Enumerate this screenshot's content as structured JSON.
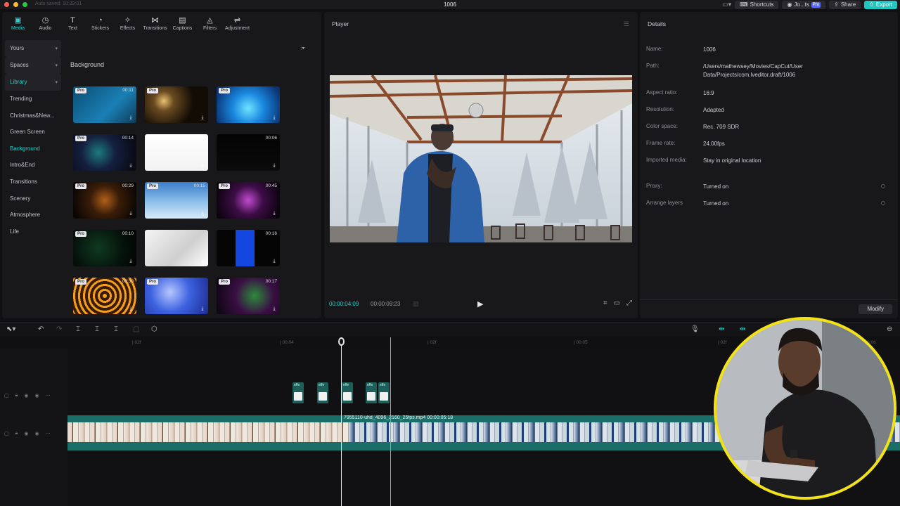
{
  "topbar": {
    "autosave": "Auto saved: 10:29:01",
    "project_title": "1006",
    "shortcuts_label": "Shortcuts",
    "user_label": "Jo...ts",
    "user_badge": "Pro",
    "share_label": "Share",
    "export_label": "Export"
  },
  "toolbar": {
    "tools": [
      {
        "label": "Media",
        "icon": "media-icon",
        "glyph": "▣"
      },
      {
        "label": "Audio",
        "icon": "audio-icon",
        "glyph": "◷"
      },
      {
        "label": "Text",
        "icon": "text-icon",
        "glyph": "T"
      },
      {
        "label": "Stickers",
        "icon": "stickers-icon",
        "glyph": "◔"
      },
      {
        "label": "Effects",
        "icon": "effects-icon",
        "glyph": "✧"
      },
      {
        "label": "Transitions",
        "icon": "transitions-icon",
        "glyph": "⋈"
      },
      {
        "label": "Captions",
        "icon": "captions-icon",
        "glyph": "▤"
      },
      {
        "label": "Filters",
        "icon": "filters-icon",
        "glyph": "◬"
      },
      {
        "label": "Adjustment",
        "icon": "adjustment-icon",
        "glyph": "⇌"
      }
    ]
  },
  "nav": {
    "items": [
      {
        "label": "Yours",
        "dropdown": true
      },
      {
        "label": "Spaces",
        "dropdown": true
      },
      {
        "label": "Library",
        "dropdown": true
      },
      {
        "label": "Trending"
      },
      {
        "label": "Christmas&New..."
      },
      {
        "label": "Green Screen"
      },
      {
        "label": "Background"
      },
      {
        "label": "Intro&End"
      },
      {
        "label": "Transitions"
      },
      {
        "label": "Scenery"
      },
      {
        "label": "Atmosphere"
      },
      {
        "label": "Life"
      }
    ]
  },
  "library": {
    "section_title": "Background",
    "filter_glyph": "⫶▾",
    "items": [
      {
        "pro": "Pro",
        "duration": "00:11"
      },
      {
        "pro": "Pro",
        "duration": ""
      },
      {
        "pro": "Pro",
        "duration": ""
      },
      {
        "pro": "Pro",
        "duration": "00:14"
      },
      {
        "pro": "",
        "duration": ""
      },
      {
        "pro": "",
        "duration": "00:06"
      },
      {
        "pro": "Pro",
        "duration": "00:29"
      },
      {
        "pro": "Pro",
        "duration": "00:15"
      },
      {
        "pro": "Pro",
        "duration": "00:45"
      },
      {
        "pro": "Pro",
        "duration": "00:10"
      },
      {
        "pro": "",
        "duration": ""
      },
      {
        "pro": "",
        "duration": "00:16"
      },
      {
        "pro": "Pro",
        "duration": "00:30"
      },
      {
        "pro": "Pro",
        "duration": ""
      },
      {
        "pro": "Pro",
        "duration": "00:17"
      }
    ]
  },
  "player": {
    "title": "Player",
    "current_time": "00:00:04:09",
    "total_time": "00:00:09:23"
  },
  "details": {
    "title": "Details",
    "rows": [
      {
        "key": "Name:",
        "value": "1006"
      },
      {
        "key": "Path:",
        "value": "/Users/mathewsey/Movies/CapCut/User Data/Projects/com.lveditor.draft/1006"
      },
      {
        "key": "Aspect ratio:",
        "value": "16:9"
      },
      {
        "key": "Resolution:",
        "value": "Adapted"
      },
      {
        "key": "Color space:",
        "value": "Rec. 709 SDR"
      },
      {
        "key": "Frame rate:",
        "value": "24.00fps"
      },
      {
        "key": "Imported media:",
        "value": "Stay in original location"
      },
      {
        "key": "Proxy:",
        "value": "Turned on"
      },
      {
        "key": "Arrange layers",
        "value": "Turned on"
      }
    ],
    "modify_label": "Modify"
  },
  "timeline": {
    "ruler": [
      "| 02f",
      "| 00:04",
      "| 02f",
      "| 00:05",
      "| 02f",
      "| 00:06"
    ],
    "clip_label": "7955110-uhd_4096_2160_25fps.mp4   00:00:05:18",
    "effect_label": "effe"
  }
}
